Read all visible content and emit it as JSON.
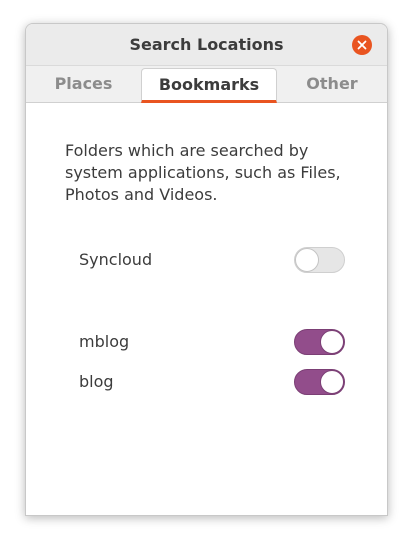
{
  "window": {
    "title": "Search Locations"
  },
  "tabs": [
    {
      "label": "Places",
      "active": false
    },
    {
      "label": "Bookmarks",
      "active": true
    },
    {
      "label": "Other",
      "active": false
    }
  ],
  "description": "Folders which are searched by system applications, such as Files, Photos and Videos.",
  "locations": [
    {
      "label": "Syncloud",
      "enabled": false
    },
    {
      "label": "mblog",
      "enabled": true
    },
    {
      "label": "blog",
      "enabled": true
    }
  ],
  "colors": {
    "accent": "#e95420",
    "switch_on": "#924d8b",
    "switch_off": "#e6e6e6"
  },
  "icons": {
    "close": "close-icon"
  }
}
